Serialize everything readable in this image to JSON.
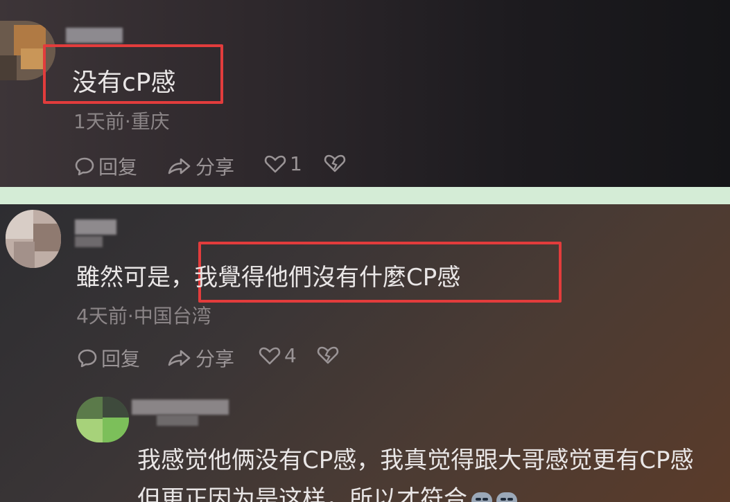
{
  "comments": [
    {
      "text": "没有cP感",
      "meta": "1天前·重庆",
      "actions": {
        "reply": "回复",
        "share": "分享",
        "like_count": "1"
      }
    },
    {
      "text_prefix": "雖然可是，",
      "text_highlight": "我覺得他們沒有什麼CP感",
      "meta": "4天前·中国台湾",
      "actions": {
        "reply": "回复",
        "share": "分享",
        "like_count": "4"
      },
      "reply": {
        "line1": "我感觉他俩没有CP感，我真觉得跟大哥感觉更有CP感",
        "line2": "但更正因为是这样，所以才符合"
      }
    }
  ],
  "colors": {
    "highlight_box": "#e23c3c",
    "divider": "#d4ecd6"
  },
  "icons": [
    "comment-icon",
    "share-icon",
    "heart-icon",
    "broken-heart-icon",
    "smirk-emoji"
  ]
}
